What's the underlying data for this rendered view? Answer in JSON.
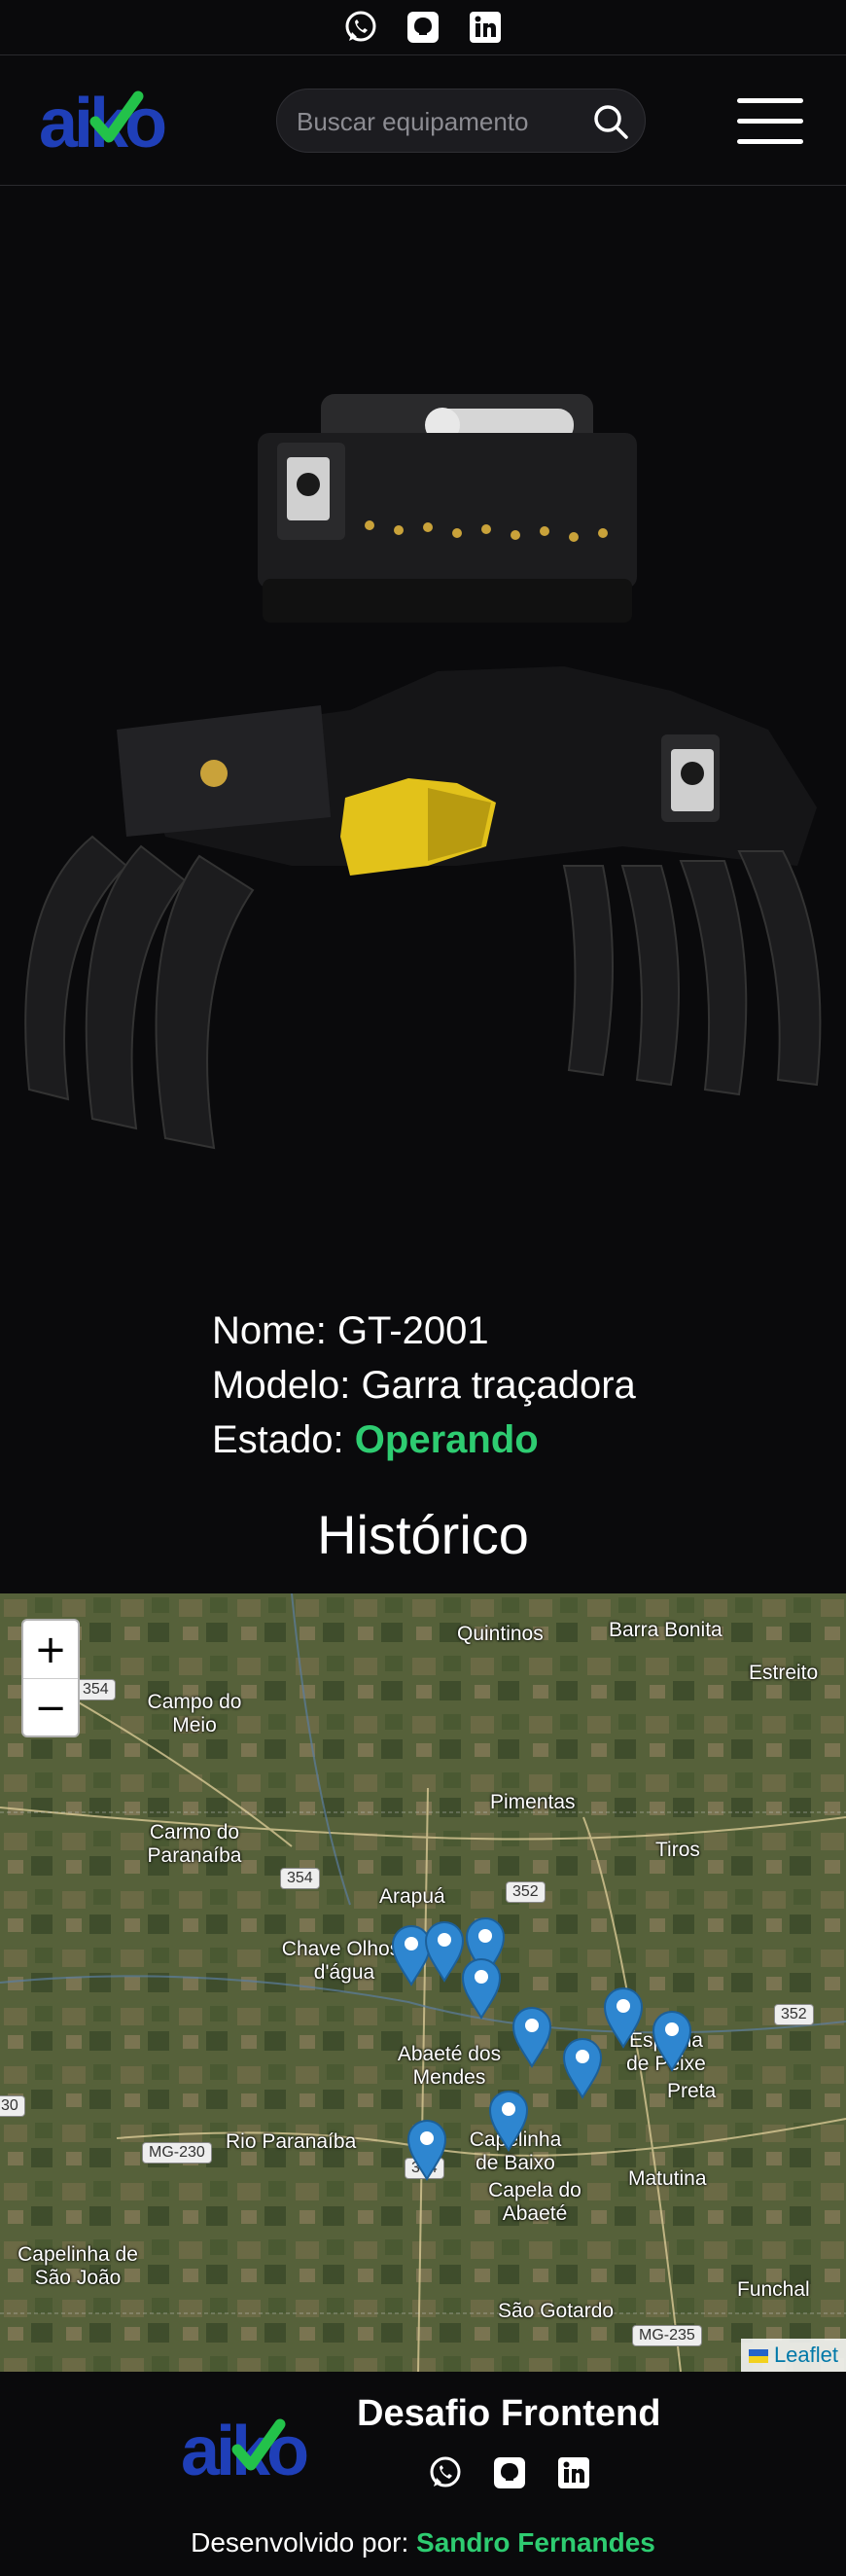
{
  "topbar": {
    "icons": [
      "whatsapp-icon",
      "github-icon",
      "linkedin-icon"
    ]
  },
  "header": {
    "logo": "aiko",
    "search": {
      "placeholder": "Buscar equipamento",
      "value": ""
    },
    "menu_icon": "hamburger-menu-icon"
  },
  "equipment": {
    "name_label": "Nome:",
    "name": "GT-2001",
    "model_label": "Modelo:",
    "model": "Garra traçadora",
    "state_label": "Estado:",
    "state": "Operando",
    "state_color": "#2ecc71",
    "image_brand": "equipment-image"
  },
  "history": {
    "title": "Histórico",
    "zoom_in": "+",
    "zoom_out": "−",
    "attribution": "Leaflet",
    "place_labels": [
      "Quintinos",
      "Barra Bonita",
      "Estreito",
      "Campo do Meio",
      "Pimentas",
      "Carmo do Paranaíba",
      "Tiros",
      "Arapuá",
      "Chave Olhos-d'água",
      "Abaeté dos Mendes",
      "Espinha de Peixe",
      "Preta",
      "Rio Paranaíba",
      "Capelinha de Baixo",
      "Capela do Abaeté",
      "Matutina",
      "Capelinha de São João",
      "Funchal",
      "São Gotardo"
    ],
    "road_labels": [
      "354",
      "354",
      "352",
      "352",
      "MG-230",
      "354",
      "MG-235",
      "30"
    ]
  },
  "footer": {
    "logo": "aiko",
    "title": "Desafio Frontend",
    "credit_prefix": "Desenvolvido por:",
    "author": "Sandro Fernandes",
    "author_color": "#2ecc71",
    "icons": [
      "whatsapp-icon",
      "github-icon",
      "linkedin-icon"
    ]
  }
}
